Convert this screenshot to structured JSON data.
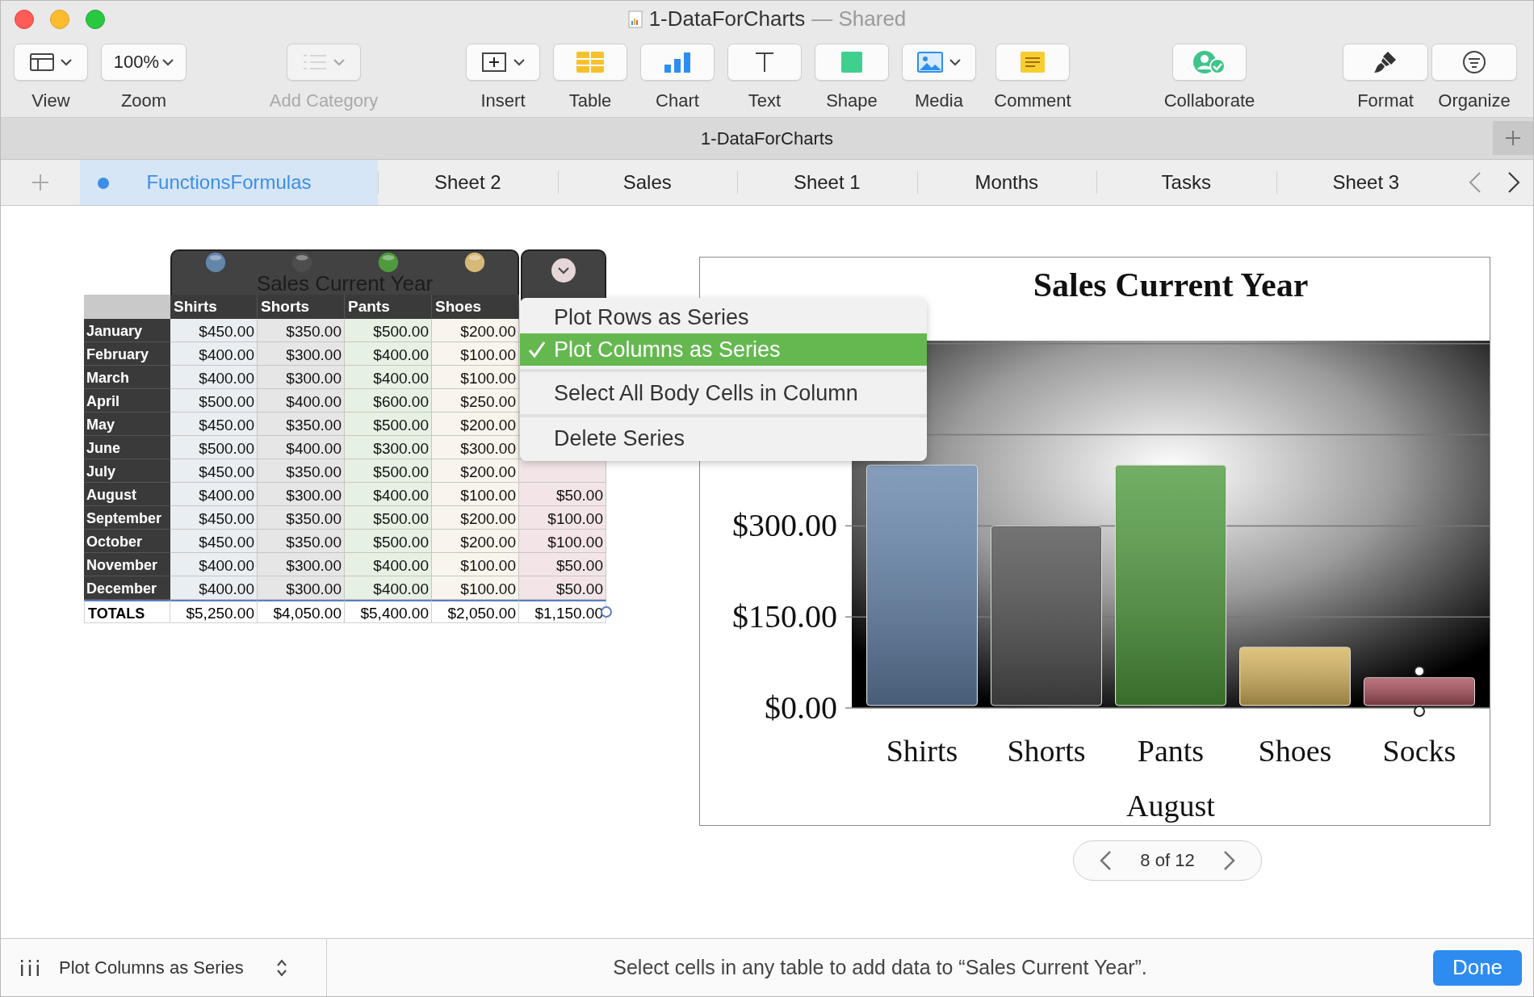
{
  "window": {
    "title": "1-DataForCharts",
    "status": "— Shared"
  },
  "toolbar": [
    {
      "label": "View",
      "kind": "view",
      "disabled": false
    },
    {
      "label": "Zoom",
      "kind": "zoom",
      "value": "100%",
      "disabled": false
    },
    {
      "label": "Add Category",
      "kind": "category",
      "disabled": true
    },
    {
      "label": "Insert",
      "kind": "insert",
      "disabled": false
    },
    {
      "label": "Table",
      "kind": "table",
      "disabled": false
    },
    {
      "label": "Chart",
      "kind": "chart",
      "disabled": false
    },
    {
      "label": "Text",
      "kind": "text",
      "disabled": false
    },
    {
      "label": "Shape",
      "kind": "shape",
      "disabled": false
    },
    {
      "label": "Media",
      "kind": "media",
      "disabled": false
    },
    {
      "label": "Comment",
      "kind": "comment",
      "disabled": false
    },
    {
      "label": "Collaborate",
      "kind": "collaborate",
      "disabled": false
    },
    {
      "label": "Format",
      "kind": "format",
      "disabled": false
    },
    {
      "label": "Organize",
      "kind": "organize",
      "disabled": false
    }
  ],
  "document_tab": {
    "title": "1-DataForCharts"
  },
  "sheets": [
    {
      "label": "FunctionsFormulas",
      "selected": true
    },
    {
      "label": "Sheet 2",
      "selected": false
    },
    {
      "label": "Sales",
      "selected": false
    },
    {
      "label": "Sheet 1",
      "selected": false
    },
    {
      "label": "Months",
      "selected": false
    },
    {
      "label": "Tasks",
      "selected": false
    },
    {
      "label": "Sheet 3",
      "selected": false
    }
  ],
  "table": {
    "title": "Sales Current Year",
    "series": [
      {
        "name": "Shirts",
        "color": "#6585ab"
      },
      {
        "name": "Shorts",
        "color": "#4d4d4d"
      },
      {
        "name": "Pants",
        "color": "#4f9a3e"
      },
      {
        "name": "Shoes",
        "color": "#d6b878"
      }
    ],
    "rows": [
      {
        "label": "January",
        "cells": [
          "$450.00",
          "$350.00",
          "$500.00",
          "$200.00"
        ]
      },
      {
        "label": "February",
        "cells": [
          "$400.00",
          "$300.00",
          "$400.00",
          "$100.00"
        ]
      },
      {
        "label": "March",
        "cells": [
          "$400.00",
          "$300.00",
          "$400.00",
          "$100.00"
        ]
      },
      {
        "label": "April",
        "cells": [
          "$500.00",
          "$400.00",
          "$600.00",
          "$250.00"
        ]
      },
      {
        "label": "May",
        "cells": [
          "$450.00",
          "$350.00",
          "$500.00",
          "$200.00"
        ]
      },
      {
        "label": "June",
        "cells": [
          "$500.00",
          "$400.00",
          "$300.00",
          "$300.00"
        ]
      },
      {
        "label": "July",
        "cells": [
          "$450.00",
          "$350.00",
          "$500.00",
          "$200.00"
        ]
      },
      {
        "label": "August",
        "cells": [
          "$400.00",
          "$300.00",
          "$400.00",
          "$100.00",
          "$50.00"
        ]
      },
      {
        "label": "September",
        "cells": [
          "$450.00",
          "$350.00",
          "$500.00",
          "$200.00",
          "$100.00"
        ]
      },
      {
        "label": "October",
        "cells": [
          "$450.00",
          "$350.00",
          "$500.00",
          "$200.00",
          "$100.00"
        ]
      },
      {
        "label": "November",
        "cells": [
          "$400.00",
          "$300.00",
          "$400.00",
          "$100.00",
          "$50.00"
        ]
      },
      {
        "label": "December",
        "cells": [
          "$400.00",
          "$300.00",
          "$400.00",
          "$100.00",
          "$50.00"
        ]
      }
    ],
    "totals": {
      "label": "TOTALS",
      "cells": [
        "$5,250.00",
        "$4,050.00",
        "$5,400.00",
        "$2,050.00",
        "$1,150.00"
      ]
    }
  },
  "series_menu": {
    "items": [
      {
        "label": "Plot Rows as Series",
        "selected": false
      },
      {
        "label": "Plot Columns as Series",
        "selected": true
      },
      {
        "label": "Select All Body Cells in Column",
        "selected": false
      },
      {
        "label": "Delete Series",
        "selected": false
      }
    ]
  },
  "chart": {
    "chart_data": {
      "type": "bar",
      "title": "Sales Current Year",
      "xlabel": "August",
      "categories": [
        "Shirts",
        "Shorts",
        "Pants",
        "Shoes",
        "Socks"
      ],
      "series": [
        {
          "color": "#6585ab",
          "values": [
            400,
            null,
            null,
            null,
            null
          ]
        },
        {
          "color": "#505050",
          "values": [
            null,
            300,
            null,
            null,
            null
          ]
        },
        {
          "color": "#4f9a3e",
          "values": [
            null,
            null,
            400,
            null,
            null
          ]
        },
        {
          "color": "#d6b45e",
          "values": [
            null,
            null,
            null,
            100,
            null
          ]
        },
        {
          "color": "#a8505c",
          "values": [
            null,
            null,
            null,
            null,
            50
          ]
        }
      ],
      "ylim": [
        0,
        605
      ],
      "yticks": [
        {
          "value": 0,
          "label": "$0.00"
        },
        {
          "value": 150,
          "label": "$150.00"
        },
        {
          "value": 300,
          "label": "$300.00"
        }
      ]
    },
    "bar_states": [
      {
        "selected": false
      },
      {
        "selected": false
      },
      {
        "selected": false
      },
      {
        "selected": false
      },
      {
        "selected": true
      }
    ],
    "pager": {
      "label": "8 of 12"
    }
  },
  "bottom_bar": {
    "mode": "Plot Columns as Series",
    "message": "Select cells in any table to add data to “Sales Current Year”.",
    "done": "Done"
  }
}
